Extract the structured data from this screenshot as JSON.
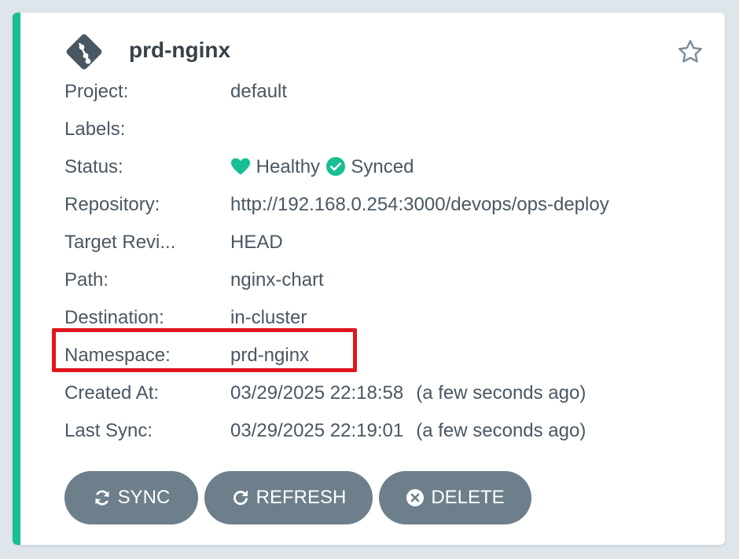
{
  "app": {
    "name": "prd-nginx",
    "logo_icon": "git-diamond-icon",
    "favorite_icon": "star-outline-icon"
  },
  "details": [
    {
      "label": "Project:",
      "value": "default"
    },
    {
      "label": "Labels:",
      "value": ""
    },
    {
      "label": "Status:",
      "health": "Healthy",
      "sync": "Synced",
      "health_icon": "heart-icon",
      "sync_icon": "check-circle-icon"
    },
    {
      "label": "Repository:",
      "value": "http://192.168.0.254:3000/devops/ops-deploy"
    },
    {
      "label": "Target Revi...",
      "value": "HEAD"
    },
    {
      "label": "Path:",
      "value": "nginx-chart"
    },
    {
      "label": "Destination:",
      "value": "in-cluster"
    },
    {
      "label": "Namespace:",
      "value": "prd-nginx"
    },
    {
      "label": "Created At:",
      "value": "03/29/2025 22:18:58",
      "relative": "(a few seconds ago)"
    },
    {
      "label": "Last Sync:",
      "value": "03/29/2025 22:19:01",
      "relative": "(a few seconds ago)"
    }
  ],
  "actions": {
    "sync": {
      "label": "SYNC",
      "icon": "sync-icon"
    },
    "refresh": {
      "label": "REFRESH",
      "icon": "refresh-icon"
    },
    "delete": {
      "label": "DELETE",
      "icon": "times-circle-icon"
    }
  },
  "colors": {
    "healthy": "#18be94",
    "synced": "#18be94",
    "status_bar": "#18be94",
    "highlight": "#e0151d",
    "button": "#6d7f8b"
  }
}
